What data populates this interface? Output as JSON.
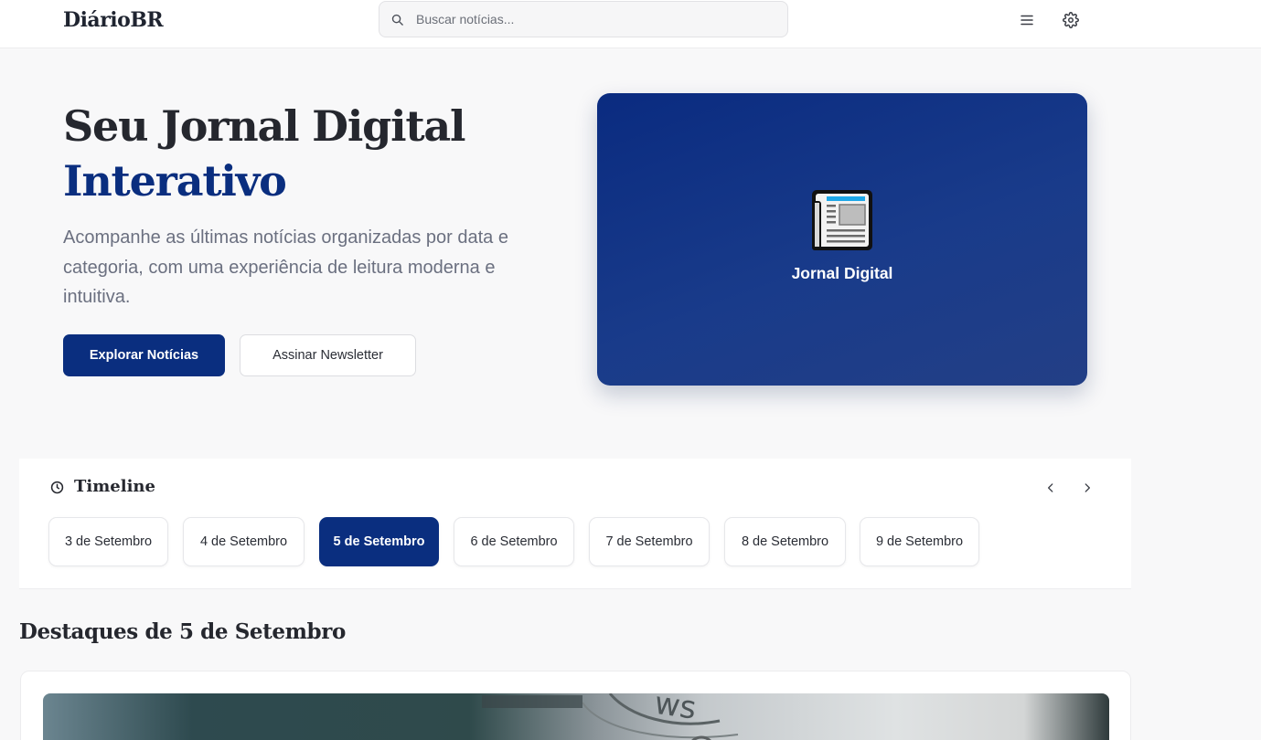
{
  "header": {
    "logo": "DiárioBR",
    "search_placeholder": "Buscar notícias...",
    "menu_icon": "menu-icon",
    "settings_icon": "gear-icon"
  },
  "hero": {
    "title_line1": "Seu Jornal Digital",
    "title_line2": "Interativo",
    "description": "Acompanhe as últimas notícias organizadas por data e categoria, com uma experiência de leitura moderna e intuitiva.",
    "primary_button": "Explorar Notícias",
    "secondary_button": "Assinar Newsletter",
    "card_icon": "newspaper-icon",
    "card_label": "Jornal Digital"
  },
  "timeline": {
    "title": "Timeline",
    "icon": "clock-icon",
    "dates": [
      {
        "label": "3 de Setembro",
        "active": false
      },
      {
        "label": "4 de Setembro",
        "active": false
      },
      {
        "label": "5 de Setembro",
        "active": true
      },
      {
        "label": "6 de Setembro",
        "active": false
      },
      {
        "label": "7 de Setembro",
        "active": false
      },
      {
        "label": "8 de Setembro",
        "active": false
      },
      {
        "label": "9 de Setembro",
        "active": false
      }
    ]
  },
  "highlights": {
    "title": "Destaques de 5 de Setembro"
  },
  "colors": {
    "brand": "#0a2e7f",
    "background": "#f8f8f9"
  }
}
